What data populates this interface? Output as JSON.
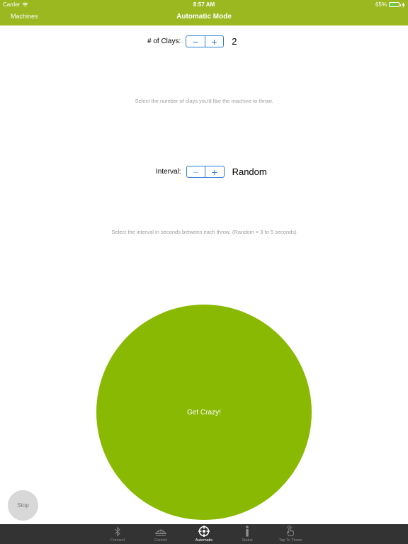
{
  "status_bar": {
    "carrier": "Carrier",
    "time": "8:57 AM",
    "battery": "65%",
    "battery_level": 0.65,
    "battery_color": "#4cd964"
  },
  "nav": {
    "back_label": "Machines",
    "title": "Automatic Mode",
    "bar_color": "#9bb821"
  },
  "clays": {
    "label": "# of Clays:",
    "minus": "−",
    "plus": "+",
    "value": "2",
    "hint": "Select the number of clays you'd like the machine to throw."
  },
  "interval": {
    "label": "Interval:",
    "minus": "−",
    "plus": "+",
    "value": "Random",
    "hint": "Select the interval in seconds between each throw. (Random = 3 to 5 seconds)"
  },
  "main_button": {
    "label": "Get Crazy!",
    "color": "#8ab903"
  },
  "stop_button": {
    "label": "Stop"
  },
  "tabbar": {
    "selected": "Automatic",
    "tabs": [
      {
        "label": "Connect",
        "icon": "bluetooth-icon"
      },
      {
        "label": "Control",
        "icon": "trap-machine-icon"
      },
      {
        "label": "Automatic",
        "icon": "crosshair-icon"
      },
      {
        "label": "Status",
        "icon": "info-icon"
      },
      {
        "label": "Tap To Throw",
        "icon": "tap-hand-icon"
      }
    ]
  }
}
